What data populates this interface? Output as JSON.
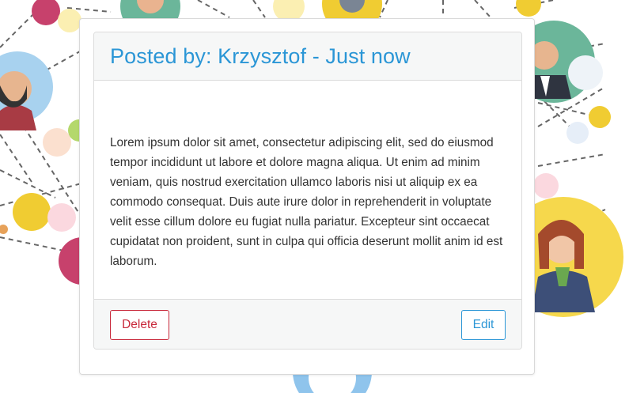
{
  "post": {
    "header": "Posted by: Krzysztof - Just now",
    "body": "Lorem ipsum dolor sit amet, consectetur adipiscing elit, sed do eiusmod tempor incididunt ut labore et dolore magna aliqua. Ut enim ad minim veniam, quis nostrud exercitation ullamco laboris nisi ut aliquip ex ea commodo consequat. Duis aute irure dolor in reprehenderit in voluptate velit esse cillum dolore eu fugiat nulla pariatur. Excepteur sint occaecat cupidatat non proident, sunt in culpa qui officia deserunt mollit anim id est laborum."
  },
  "actions": {
    "delete_label": "Delete",
    "edit_label": "Edit"
  },
  "colors": {
    "accent": "#2b96d6",
    "danger": "#c8283a",
    "header_bg": "#f6f7f7"
  }
}
